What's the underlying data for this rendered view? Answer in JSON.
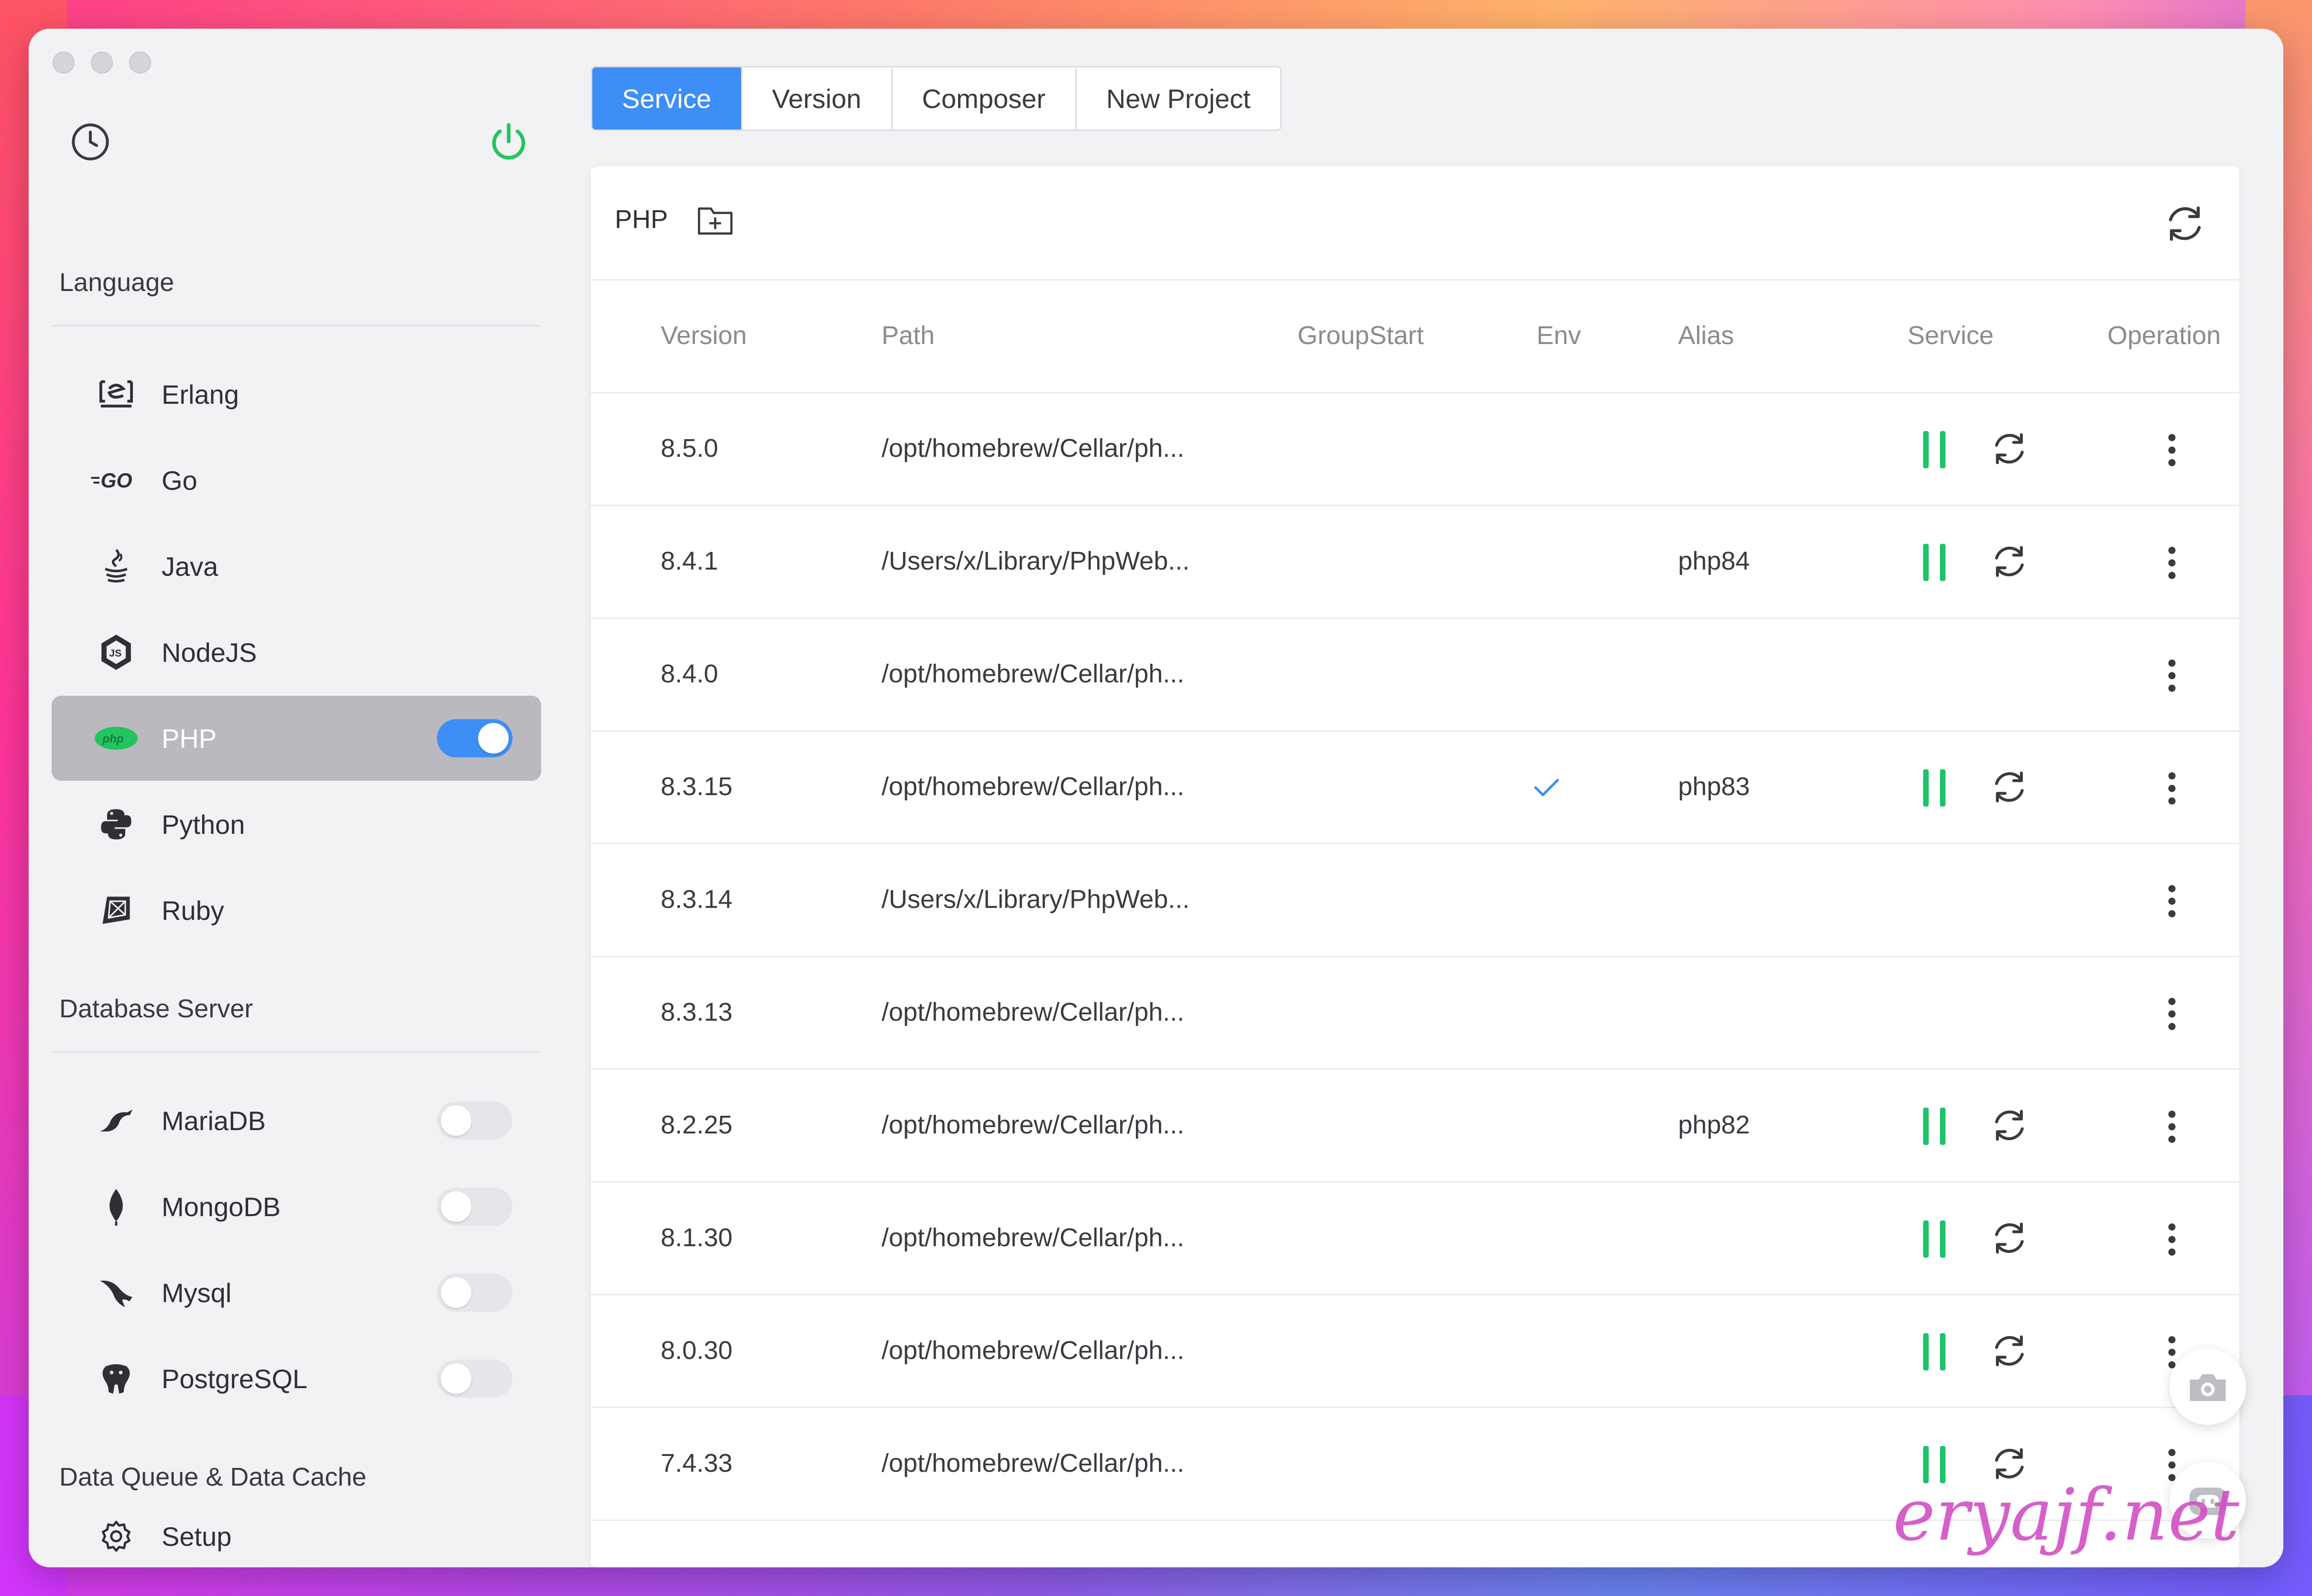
{
  "tabs": [
    {
      "label": "Service",
      "active": true
    },
    {
      "label": "Version"
    },
    {
      "label": "Composer"
    },
    {
      "label": "New Project"
    }
  ],
  "sidebar": {
    "section_language": "Language",
    "language_items": [
      {
        "label": "Erlang",
        "icon": "erlang-icon"
      },
      {
        "label": "Go",
        "icon": "go-icon"
      },
      {
        "label": "Java",
        "icon": "java-icon"
      },
      {
        "label": "NodeJS",
        "icon": "nodejs-icon"
      },
      {
        "label": "PHP",
        "icon": "php-icon",
        "active": true,
        "toggle": true
      },
      {
        "label": "Python",
        "icon": "python-icon"
      },
      {
        "label": "Ruby",
        "icon": "ruby-icon"
      }
    ],
    "section_database": "Database Server",
    "database_items": [
      {
        "label": "MariaDB",
        "icon": "mariadb-icon",
        "toggle": false
      },
      {
        "label": "MongoDB",
        "icon": "mongodb-icon",
        "toggle": false
      },
      {
        "label": "Mysql",
        "icon": "mysql-icon",
        "toggle": false
      },
      {
        "label": "PostgreSQL",
        "icon": "postgresql-icon",
        "toggle": false
      }
    ],
    "section_queue": "Data Queue & Data Cache",
    "setup_label": "Setup"
  },
  "card": {
    "title": "PHP",
    "columns": [
      "Version",
      "Path",
      "GroupStart",
      "Env",
      "Alias",
      "Service",
      "Operation"
    ],
    "rows": [
      {
        "version": "8.5.0",
        "path": "/opt/homebrew/Cellar/ph...",
        "env": false,
        "alias": "",
        "service": true
      },
      {
        "version": "8.4.1",
        "path": "/Users/x/Library/PhpWeb...",
        "env": false,
        "alias": "php84",
        "service": true
      },
      {
        "version": "8.4.0",
        "path": "/opt/homebrew/Cellar/ph...",
        "env": false,
        "alias": "",
        "service": false
      },
      {
        "version": "8.3.15",
        "path": "/opt/homebrew/Cellar/ph...",
        "env": true,
        "alias": "php83",
        "service": true
      },
      {
        "version": "8.3.14",
        "path": "/Users/x/Library/PhpWeb...",
        "env": false,
        "alias": "",
        "service": false
      },
      {
        "version": "8.3.13",
        "path": "/opt/homebrew/Cellar/ph...",
        "env": false,
        "alias": "",
        "service": false
      },
      {
        "version": "8.2.25",
        "path": "/opt/homebrew/Cellar/ph...",
        "env": false,
        "alias": "php82",
        "service": true
      },
      {
        "version": "8.1.30",
        "path": "/opt/homebrew/Cellar/ph...",
        "env": false,
        "alias": "",
        "service": true
      },
      {
        "version": "8.0.30",
        "path": "/opt/homebrew/Cellar/ph...",
        "env": false,
        "alias": "",
        "service": true
      },
      {
        "version": "7.4.33",
        "path": "/opt/homebrew/Cellar/ph...",
        "env": false,
        "alias": "",
        "service": true
      }
    ]
  },
  "watermark": "eryajf.net",
  "colors": {
    "accent": "#3d8ef7",
    "running": "#1ec26a",
    "power": "#22c55e"
  }
}
